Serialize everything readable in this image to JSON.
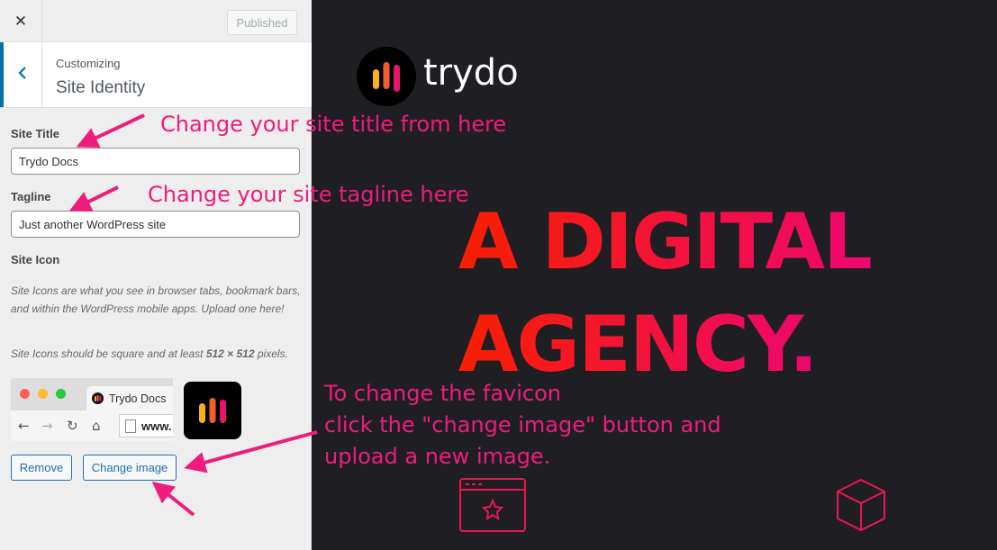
{
  "topbar": {
    "close_glyph": "✕",
    "publish_label": "Published"
  },
  "section": {
    "back_glyph": "‹",
    "crumb": "Customizing",
    "title": "Site Identity"
  },
  "site_title": {
    "label": "Site Title",
    "value": "Trydo Docs"
  },
  "tagline": {
    "label": "Tagline",
    "value": "Just another WordPress site"
  },
  "site_icon": {
    "label": "Site Icon",
    "desc1": "Site Icons are what you see in browser tabs, bookmark bars, and within the WordPress mobile apps. Upload one here!",
    "desc2_pre": "Site Icons should be square and at least ",
    "desc2_bold": "512 × 512",
    "desc2_post": " pixels.",
    "tab_title": "Trydo Docs",
    "url_text": "www.",
    "remove_label": "Remove",
    "change_label": "Change image"
  },
  "preview": {
    "logo_text": "trydo",
    "hero_line1": "A DIGITAL",
    "hero_line2": "AGENCY."
  },
  "annotations": {
    "title_note": "Change your site title from here",
    "tagline_note": "Change your site tagline here",
    "favicon_note1": "To change the favicon",
    "favicon_note2": "click the \"change image\" button and",
    "favicon_note3": "upload a new image."
  },
  "colors": {
    "accent": "#0073aa",
    "annotation": "#ee1c7c",
    "hero_start": "#f81f01",
    "hero_end": "#ee076e",
    "logo_bar_yellow": "#f9b215",
    "logo_bar_red": "#e5156b"
  }
}
